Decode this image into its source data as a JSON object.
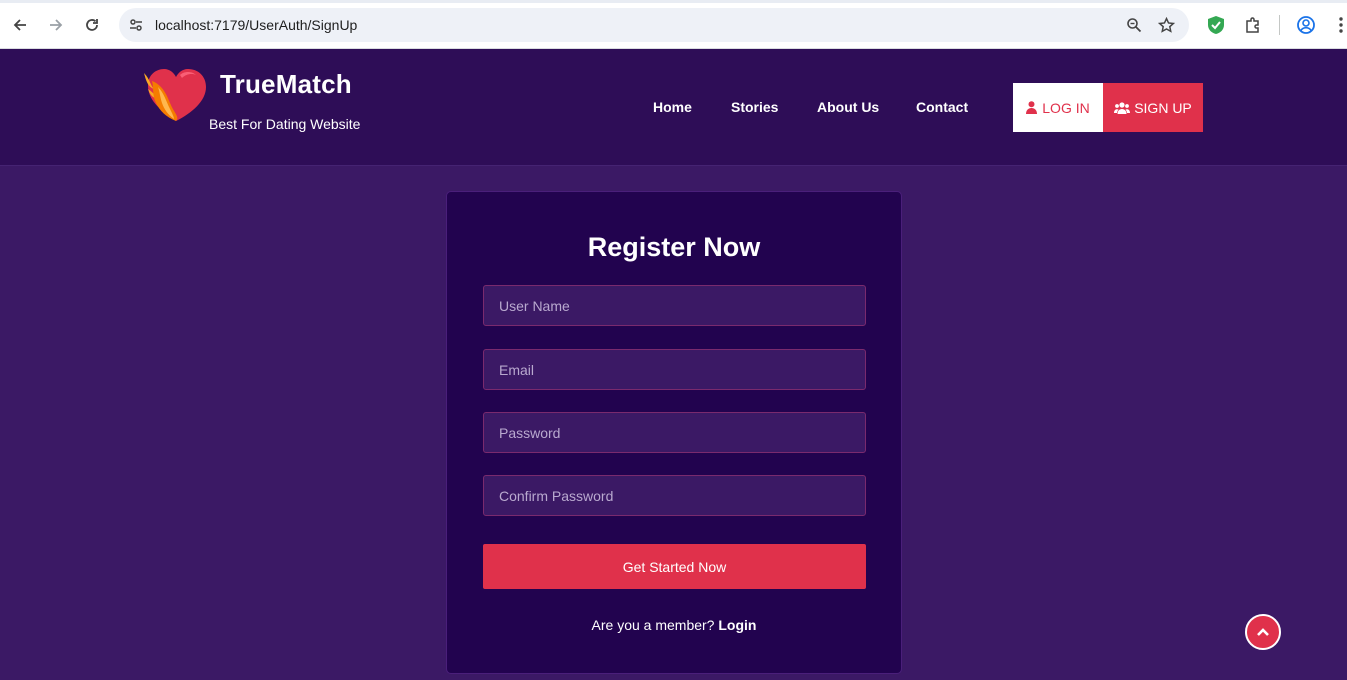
{
  "browser": {
    "url": "localhost:7179/UserAuth/SignUp"
  },
  "header": {
    "brand_name": "TrueMatch",
    "tagline": "Best For Dating Website",
    "nav": [
      {
        "label": "Home"
      },
      {
        "label": "Stories"
      },
      {
        "label": "About Us"
      },
      {
        "label": "Contact"
      }
    ],
    "login_label": "LOG IN",
    "signup_label": "SIGN UP"
  },
  "form": {
    "title": "Register Now",
    "username_placeholder": "User Name",
    "email_placeholder": "Email",
    "password_placeholder": "Password",
    "confirm_placeholder": "Confirm Password",
    "submit_label": "Get Started Now",
    "member_prompt": "Are you a member?",
    "login_link": "Login"
  },
  "colors": {
    "page_bg": "#3b1965",
    "header_bg": "#2e0d57",
    "card_bg": "#22034f",
    "accent": "#e0314b"
  },
  "icons": {
    "back": "arrow-left-icon",
    "forward": "arrow-right-icon",
    "reload": "reload-icon",
    "site_info": "tune-icon",
    "zoom": "zoom-icon",
    "bookmark": "star-icon",
    "extension_shield": "shield-icon",
    "extensions": "puzzle-icon",
    "profile": "profile-icon",
    "menu": "kebab-menu-icon",
    "logo": "heart-flame-logo",
    "login": "user-icon",
    "signup": "users-icon",
    "scroll_top": "chevron-up-icon"
  }
}
